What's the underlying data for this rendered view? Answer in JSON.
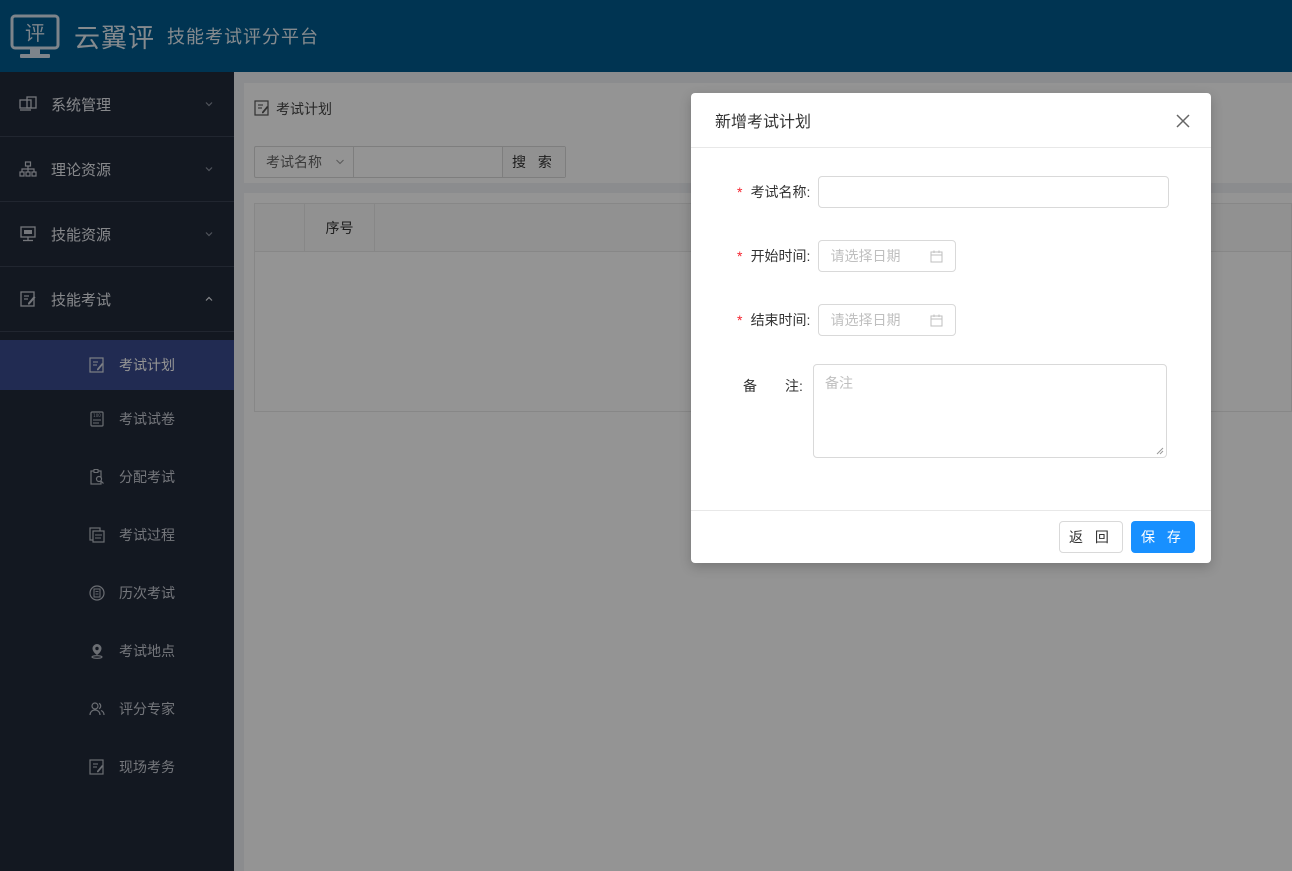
{
  "header": {
    "logo_char": "评",
    "brand_name": "云翼评",
    "brand_sub": "技能考试评分平台"
  },
  "sidebar": {
    "groups": [
      {
        "label": "系统管理",
        "icon": "monitor-icon"
      },
      {
        "label": "理论资源",
        "icon": "org-tree-icon"
      },
      {
        "label": "技能资源",
        "icon": "screen-icon"
      },
      {
        "label": "技能考试",
        "icon": "edit-icon",
        "expanded": true
      }
    ],
    "subitems": [
      {
        "label": "考试计划",
        "icon": "edit-doc-icon",
        "active": true
      },
      {
        "label": "考试试卷",
        "icon": "score-paper-icon"
      },
      {
        "label": "分配考试",
        "icon": "clipboard-search-icon"
      },
      {
        "label": "考试过程",
        "icon": "copy-doc-icon"
      },
      {
        "label": "历次考试",
        "icon": "history-icon"
      },
      {
        "label": "考试地点",
        "icon": "location-icon"
      },
      {
        "label": "评分专家",
        "icon": "user-group-icon"
      },
      {
        "label": "现场考务",
        "icon": "edit-doc-icon"
      }
    ]
  },
  "main": {
    "breadcrumb": "考试计划",
    "search": {
      "field_select": "考试名称",
      "button": "搜 索"
    },
    "table": {
      "headers": [
        "",
        "序号"
      ]
    }
  },
  "modal": {
    "title": "新增考试计划",
    "fields": {
      "name_label": "考试名称:",
      "start_label": "开始时间:",
      "end_label": "结束时间:",
      "remark_label": "备　　注:",
      "start_placeholder": "请选择日期",
      "end_placeholder": "请选择日期",
      "remark_placeholder": "备注",
      "required_mark": "*"
    },
    "buttons": {
      "back": "返 回",
      "save": "保 存"
    }
  },
  "colors": {
    "header_bg": "#005a8d",
    "sidebar_bg": "#222a3a",
    "active_item_bg": "#3a4b8e",
    "primary_button": "#1890ff",
    "required_mark": "#f5222d"
  }
}
